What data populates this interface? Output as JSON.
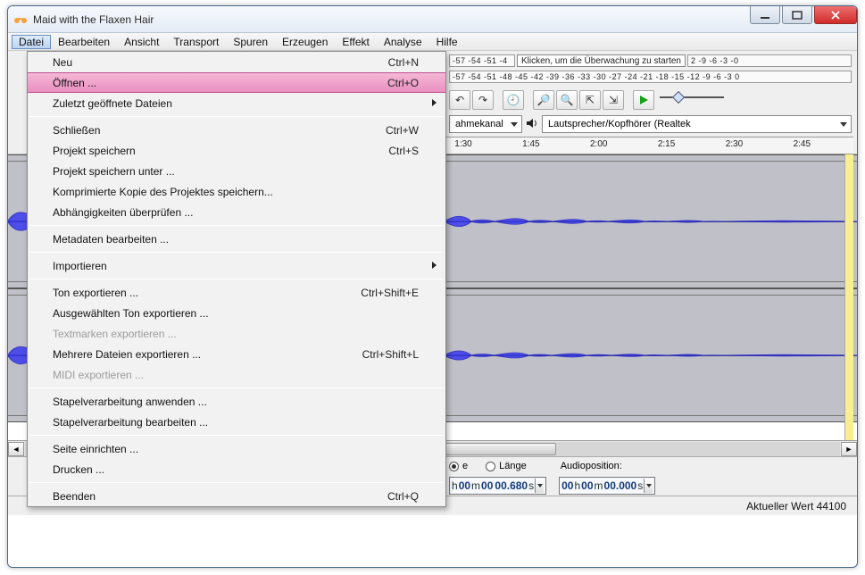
{
  "window": {
    "title": "Maid with the Flaxen Hair"
  },
  "menubar": [
    "Datei",
    "Bearbeiten",
    "Ansicht",
    "Transport",
    "Spuren",
    "Erzeugen",
    "Effekt",
    "Analyse",
    "Hilfe"
  ],
  "menubar_open_index": 0,
  "file_menu": {
    "items": [
      {
        "label": "Neu",
        "shortcut": "Ctrl+N"
      },
      {
        "label": "Öffnen ...",
        "shortcut": "Ctrl+O",
        "highlight": true
      },
      {
        "label": "Zuletzt geöffnete Dateien",
        "submenu": true
      },
      {
        "sep": true
      },
      {
        "label": "Schließen",
        "shortcut": "Ctrl+W"
      },
      {
        "label": "Projekt speichern",
        "shortcut": "Ctrl+S"
      },
      {
        "label": "Projekt speichern unter ..."
      },
      {
        "label": "Komprimierte Kopie des Projektes speichern..."
      },
      {
        "label": "Abhängigkeiten überprüfen ..."
      },
      {
        "sep": true
      },
      {
        "label": "Metadaten bearbeiten ..."
      },
      {
        "sep": true
      },
      {
        "label": "Importieren",
        "submenu": true
      },
      {
        "sep": true
      },
      {
        "label": "Ton exportieren ...",
        "shortcut": "Ctrl+Shift+E"
      },
      {
        "label": "Ausgewählten Ton exportieren ..."
      },
      {
        "label": "Textmarken exportieren ...",
        "disabled": true
      },
      {
        "label": "Mehrere Dateien exportieren ...",
        "shortcut": "Ctrl+Shift+L"
      },
      {
        "label": "MIDI exportieren ...",
        "disabled": true
      },
      {
        "sep": true
      },
      {
        "label": "Stapelverarbeitung anwenden ..."
      },
      {
        "label": "Stapelverarbeitung bearbeiten ..."
      },
      {
        "sep": true
      },
      {
        "label": "Seite einrichten ..."
      },
      {
        "label": "Drucken ..."
      },
      {
        "sep": true
      },
      {
        "label": "Beenden",
        "shortcut": "Ctrl+Q"
      }
    ]
  },
  "meters": {
    "rec_scale": "-57 -54 -51 -4",
    "rec_hint": "Klicken, um die Überwachung zu starten",
    "rec_right_scale": "2 -9 -6 -3 -0",
    "play_scale": "-57 -54 -51 -48 -45 -42 -39 -36 -33 -30 -27 -24 -21 -18 -15 -12  -9  -6  -3  0"
  },
  "device_row": {
    "rec_channel_label": "ahmekanal",
    "output_device": "Lautsprecher/Kopfhörer (Realtek"
  },
  "timeline_ticks": [
    "1:30",
    "1:45",
    "2:00",
    "2:15",
    "2:30",
    "2:45"
  ],
  "selection_bar": {
    "end_radio_label": "e",
    "length_radio_label": "Länge",
    "length_checked": false,
    "end_checked": true,
    "audiopos_label": "Audioposition:",
    "end_time": {
      "h": "00",
      "m": "00",
      "s": "00.680"
    },
    "audiopos_time": {
      "h": "00",
      "m": "00",
      "s": "00.000"
    }
  },
  "status": {
    "text": "Aktueller Wert 44100"
  }
}
